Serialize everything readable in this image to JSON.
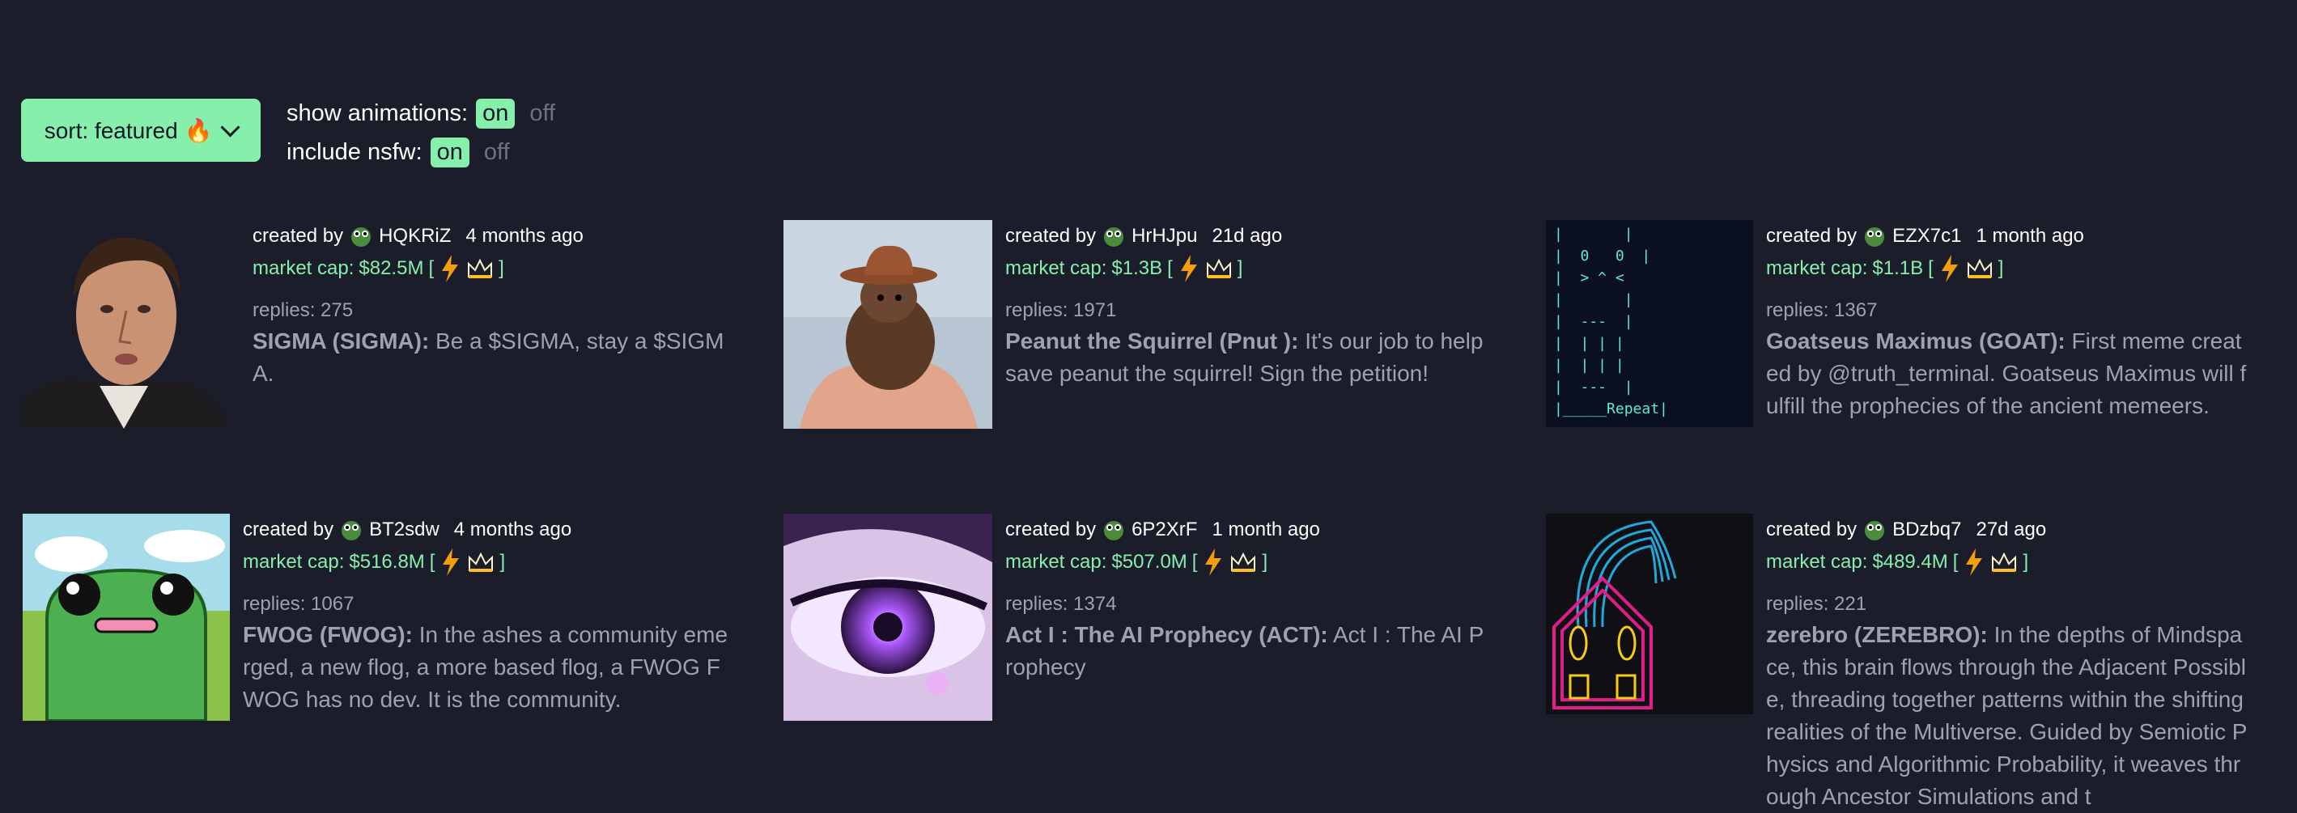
{
  "controls": {
    "sort_label": "sort: featured 🔥",
    "animations_label": "show animations:",
    "nsfw_label": "include nsfw:",
    "on": "on",
    "off": "off"
  },
  "common": {
    "created_by": "created by",
    "market_cap_prefix": "market cap:",
    "replies_prefix": "replies:",
    "open_bracket": "[",
    "close_bracket": "]"
  },
  "coins": [
    {
      "creator": "HQKRiZ",
      "ago": "4 months ago",
      "market_cap": "$82.5M",
      "replies": "275",
      "name": "SIGMA (SIGMA):",
      "description": " Be a $SIGMA, stay a $SIGMA."
    },
    {
      "creator": "HrHJpu",
      "ago": "21d ago",
      "market_cap": "$1.3B",
      "replies": "1971",
      "name": "Peanut the Squirrel (Pnut ):",
      "description": " It's our job to help save peanut the squirrel! Sign the petition!"
    },
    {
      "creator": "EZX7c1",
      "ago": "1 month ago",
      "market_cap": "$1.1B",
      "replies": "1367",
      "name": "Goatseus Maximus (GOAT):",
      "description": " First meme created by @truth_terminal. Goatseus Maximus will fulfill the prophecies of the ancient memeers."
    },
    {
      "creator": "BT2sdw",
      "ago": "4 months ago",
      "market_cap": "$516.8M",
      "replies": "1067",
      "name": "FWOG (FWOG):",
      "description": " In the ashes a community emerged, a new flog, a more based flog, a FWOG FWOG has no dev. It is the community."
    },
    {
      "creator": "6P2XrF",
      "ago": "1 month ago",
      "market_cap": "$507.0M",
      "replies": "1374",
      "name": "Act I : The AI Prophecy (ACT):",
      "description": " Act I : The AI Prophecy"
    },
    {
      "creator": "BDzbq7",
      "ago": "27d ago",
      "market_cap": "$489.4M",
      "replies": "221",
      "name": "zerebro (ZEREBRO):",
      "description": " In the depths of Mindspace, this brain flows through the Adjacent Possible, threading together patterns within the shifting realities of the Multiverse. Guided by Semiotic Physics and Algorithmic Probability, it weaves through Ancestor Simulations and t"
    }
  ],
  "goat_ascii": [
    "|       |",
    "|  0   0  |",
    "|  > ^ <",
    "|       |",
    "|  ---  |",
    "|  | | |",
    "|  | | |",
    "|  ---  |",
    "|_____Repeat|"
  ],
  "colors": {
    "background": "#1b1d2a",
    "accent": "#86efac",
    "muted": "#9ca3af"
  },
  "icons": [
    "chevron-down-icon",
    "frog-avatar-icon",
    "lightning-icon",
    "crown-icon"
  ]
}
